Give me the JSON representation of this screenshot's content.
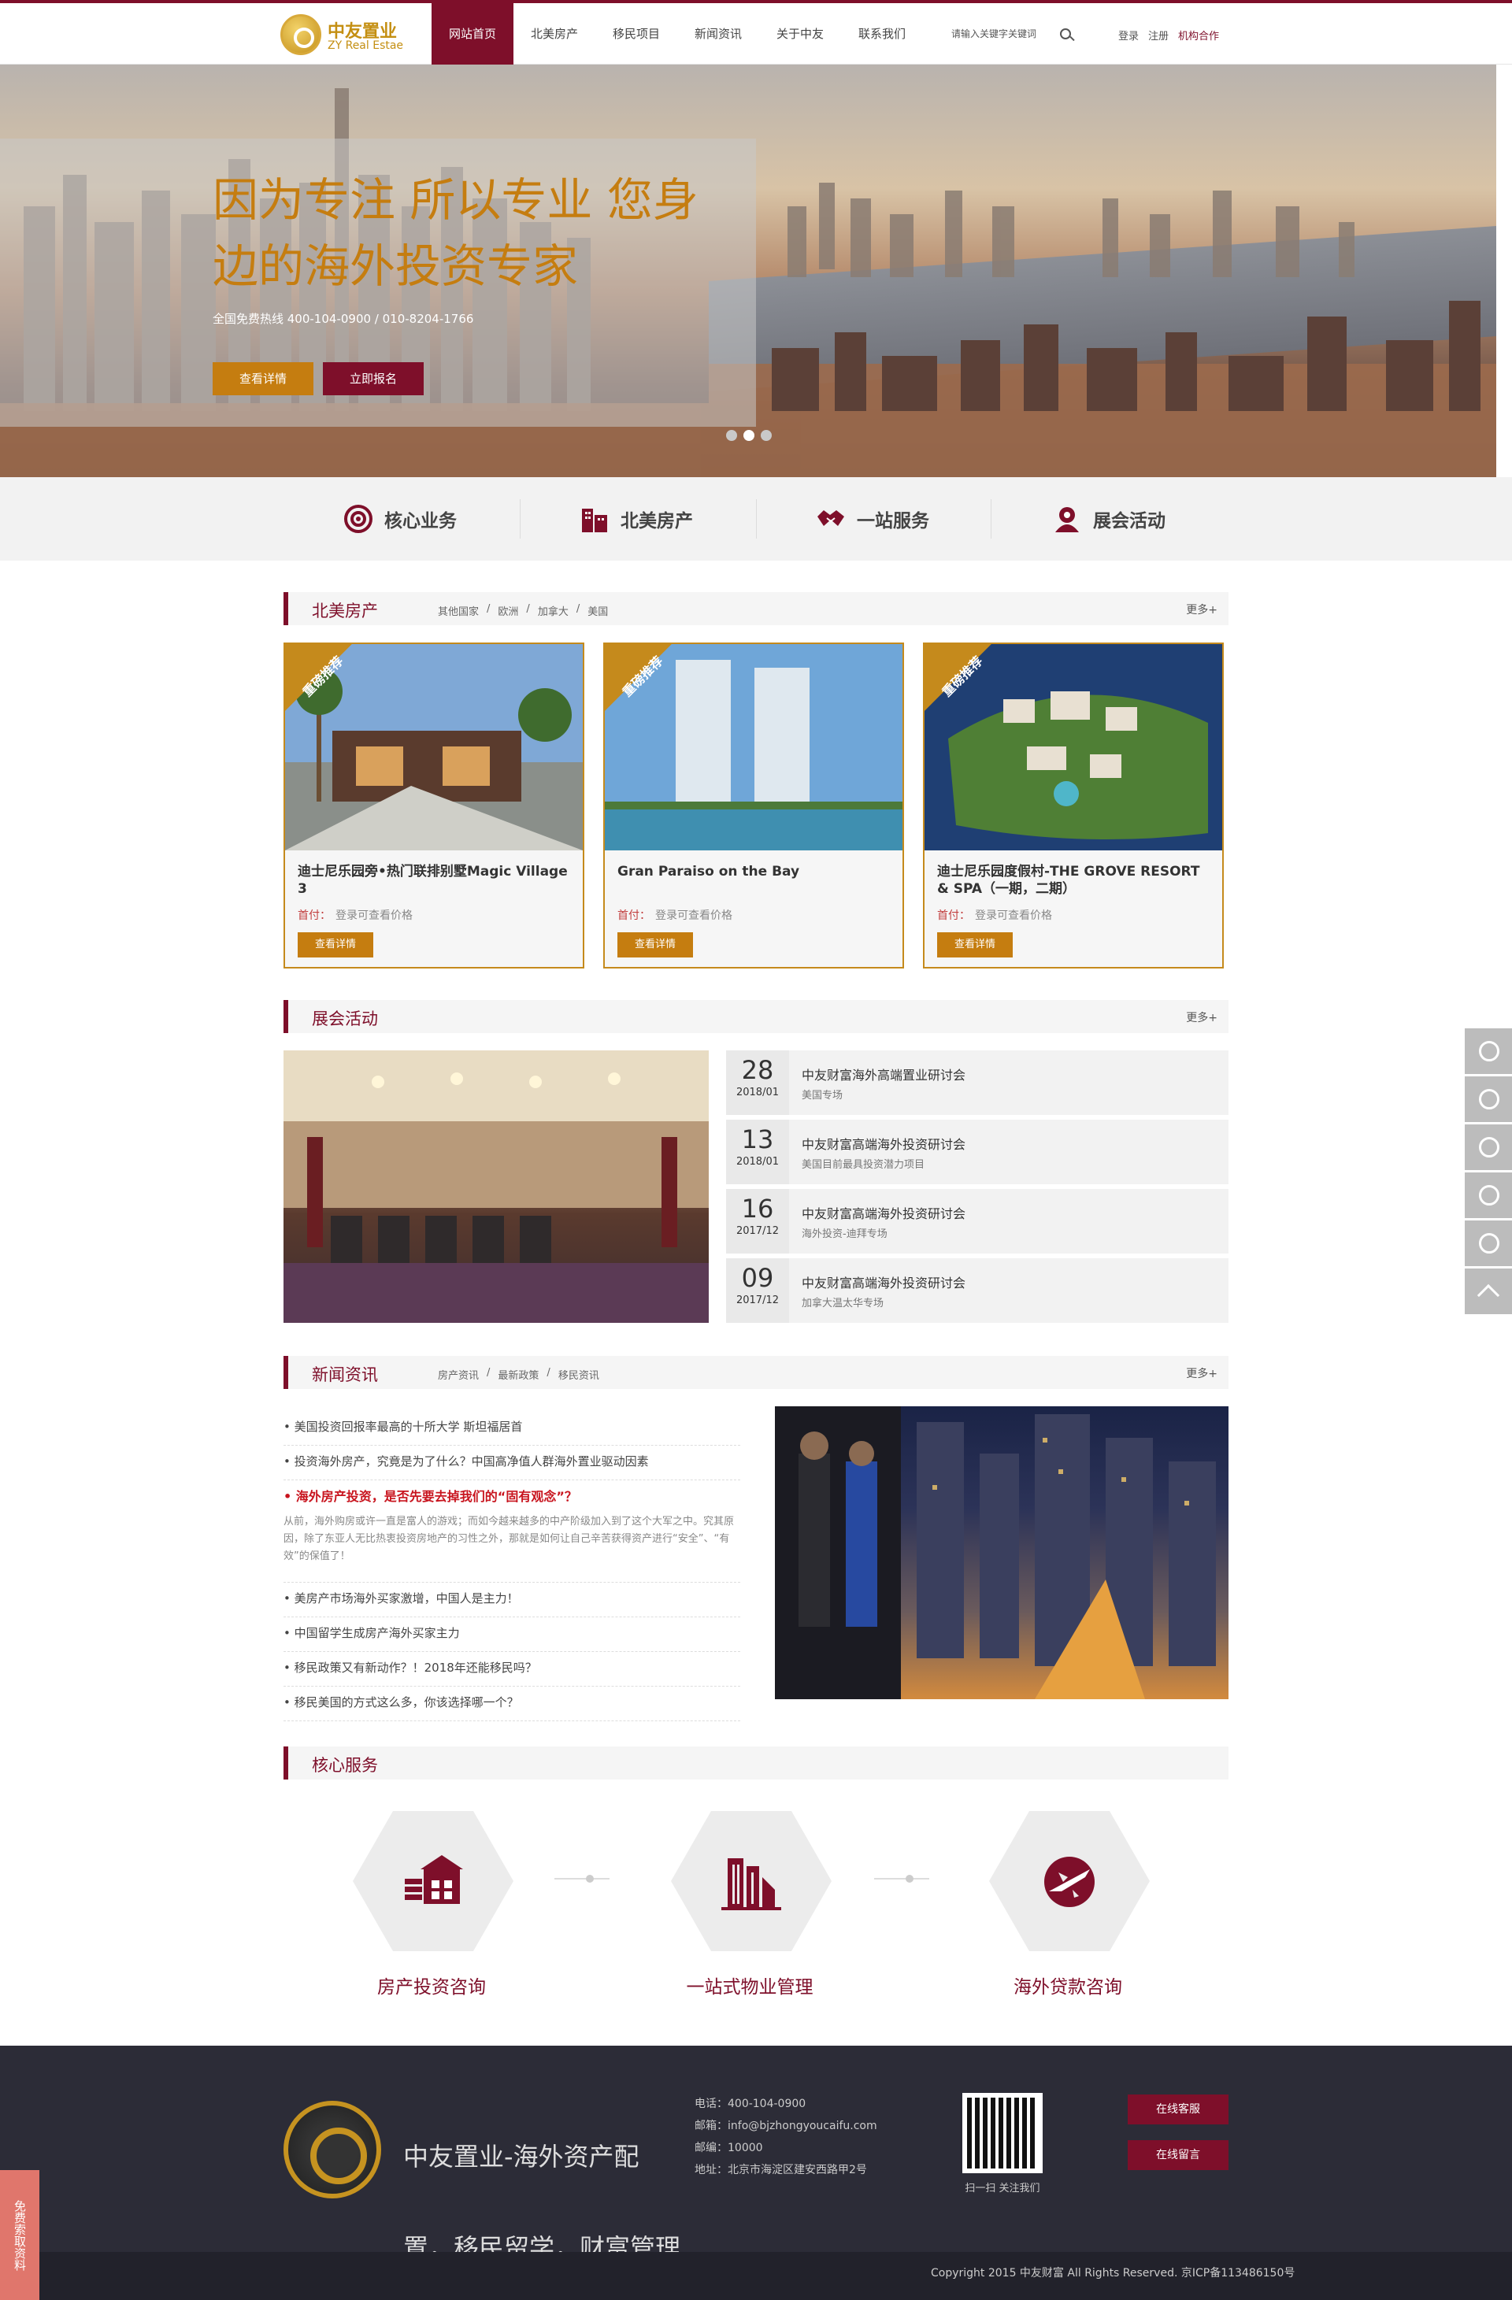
{
  "brand": {
    "name_cn": "中友置业",
    "name_en": "ZY Real Estae"
  },
  "nav": {
    "items": [
      "网站首页",
      "北美房产",
      "移民项目",
      "新闻资讯",
      "关于中友",
      "联系我们"
    ],
    "active_index": 0
  },
  "search": {
    "placeholder": "请输入关键字关键词"
  },
  "user_links": {
    "login": "登录",
    "register": "注册",
    "org": "机构合作"
  },
  "hero": {
    "title": "因为专注 所以专业 您身边的海外投资专家",
    "hotline": "全国免费热线 400-104-0900 / 010-8204-1766",
    "btn_detail": "查看详情",
    "btn_signup": "立即报名",
    "slide_count": 3,
    "active_slide": 1
  },
  "quick": [
    "核心业务",
    "北美房产",
    "一站服务",
    "展会活动"
  ],
  "sections": {
    "property": {
      "title": "北美房产",
      "subs": [
        "其他国家",
        "/",
        "欧洲",
        "/",
        "加拿大",
        "/",
        "美国"
      ],
      "more": "更多+"
    },
    "expo": {
      "title": "展会活动",
      "more": "更多+"
    },
    "news": {
      "title": "新闻资讯",
      "subs": [
        "房产资讯",
        "/",
        "最新政策",
        "/",
        "移民资讯"
      ],
      "more": "更多+"
    },
    "service": {
      "title": "核心服务"
    }
  },
  "cards": [
    {
      "ribbon": "重磅推荐",
      "title": "迪士尼乐园旁•热门联排别墅Magic Village 3",
      "price_label": "首付：",
      "price": "登录可查看价格",
      "btn": "查看详情"
    },
    {
      "ribbon": "重磅推荐",
      "title": "Gran Paraiso on the Bay",
      "price_label": "首付：",
      "price": "登录可查看价格",
      "btn": "查看详情"
    },
    {
      "ribbon": "重磅推荐",
      "title": "迪士尼乐园度假村-THE GROVE RESORT & SPA（一期，二期）",
      "price_label": "首付：",
      "price": "登录可查看价格",
      "btn": "查看详情"
    }
  ],
  "events": [
    {
      "day": "28",
      "ym": "2018/01",
      "title": "中友财富海外高端置业研讨会",
      "desc": "美国专场"
    },
    {
      "day": "13",
      "ym": "2018/01",
      "title": "中友财富高端海外投资研讨会",
      "desc": "美国目前最具投资潜力项目"
    },
    {
      "day": "16",
      "ym": "2017/12",
      "title": "中友财富高端海外投资研讨会",
      "desc": "海外投资-迪拜专场"
    },
    {
      "day": "09",
      "ym": "2017/12",
      "title": "中友财富高端海外投资研讨会",
      "desc": "加拿大温太华专场"
    }
  ],
  "news": {
    "items_before": [
      "• 美国投资回报率最高的十所大学 斯坦福居首",
      "• 投资海外房产，究竟是为了什么？中国高净值人群海外置业驱动因素"
    ],
    "highlight": {
      "title": "• 海外房产投资，是否先要去掉我们的“固有观念”？",
      "body": "从前，海外购房或许一直是富人的游戏；而如今越来越多的中产阶级加入到了这个大军之中。究其原因，除了东亚人无比热衷投资房地产的习性之外，那就是如何让自己辛苦获得资产进行“安全”、“有效”的保值了！"
    },
    "items_after": [
      "• 美房产市场海外买家激增，中国人是主力！",
      "• 中国留学生成房产海外买家主力",
      "• 移民政策又有新动作？！2018年还能移民吗？",
      "• 移民美国的方式这么多，你该选择哪一个？"
    ]
  },
  "services": [
    "房产投资咨询",
    "一站式物业管理",
    "海外贷款咨询"
  ],
  "footer": {
    "slogan": "中友置业-海外资产配",
    "slogan2": "置，移民留学，财富管理",
    "phone": "电话：400-104-0900",
    "email": "邮箱：info@bjzhongyoucaifu.com",
    "zip": "邮编：10000",
    "address": "地址：北京市海淀区建安西路甲2号",
    "qr_label": "扫一扫 关注我们",
    "btn_service": "在线客服",
    "btn_message": "在线留言",
    "copyright": "Copyright 2015 中友财富 All Rights Reserved. 京ICP备113486150号"
  },
  "side_tab": "免费索取资料",
  "colors": {
    "brand": "#7e0f2a",
    "gold": "#c57d10",
    "footer": "#2c2c37"
  }
}
